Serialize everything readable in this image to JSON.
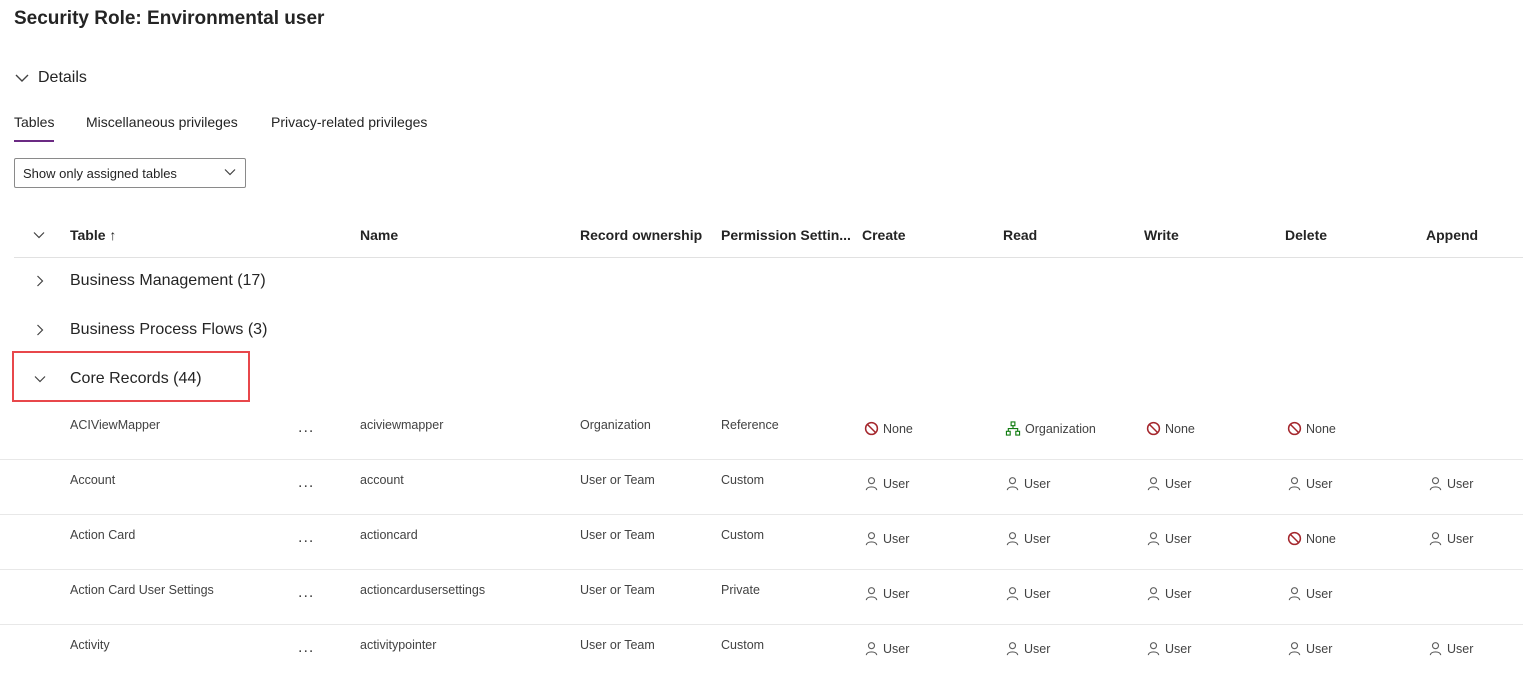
{
  "page_title": "Security Role: Environmental user",
  "details_label": "Details",
  "tabs": [
    {
      "label": "Tables",
      "active": true
    },
    {
      "label": "Miscellaneous privileges",
      "active": false
    },
    {
      "label": "Privacy-related privileges",
      "active": false
    }
  ],
  "filter": {
    "value": "Show only assigned tables"
  },
  "columns": {
    "table": "Table ↑",
    "name": "Name",
    "ownership": "Record ownership",
    "permission": "Permission Settin...",
    "create": "Create",
    "read": "Read",
    "write": "Write",
    "delete": "Delete",
    "append": "Append"
  },
  "groups": [
    {
      "label": "Business Management (17)",
      "expanded": false
    },
    {
      "label": "Business Process Flows (3)",
      "expanded": false
    },
    {
      "label": "Core Records (44)",
      "expanded": true
    }
  ],
  "rows": [
    {
      "table": "ACIViewMapper",
      "more": "...",
      "name": "aciviewmapper",
      "ownership": "Organization",
      "permission": "Reference",
      "create": {
        "icon": "none-icon",
        "label": "None"
      },
      "read": {
        "icon": "organization-icon",
        "label": "Organization"
      },
      "write": {
        "icon": "none-icon",
        "label": "None"
      },
      "delete": {
        "icon": "none-icon",
        "label": "None"
      },
      "append": null
    },
    {
      "table": "Account",
      "more": "...",
      "name": "account",
      "ownership": "User or Team",
      "permission": "Custom",
      "create": {
        "icon": "user-icon",
        "label": "User"
      },
      "read": {
        "icon": "user-icon",
        "label": "User"
      },
      "write": {
        "icon": "user-icon",
        "label": "User"
      },
      "delete": {
        "icon": "user-icon",
        "label": "User"
      },
      "append": {
        "icon": "user-icon",
        "label": "User"
      }
    },
    {
      "table": "Action Card",
      "more": "...",
      "name": "actioncard",
      "ownership": "User or Team",
      "permission": "Custom",
      "create": {
        "icon": "user-icon",
        "label": "User"
      },
      "read": {
        "icon": "user-icon",
        "label": "User"
      },
      "write": {
        "icon": "user-icon",
        "label": "User"
      },
      "delete": {
        "icon": "none-icon",
        "label": "None"
      },
      "append": {
        "icon": "user-icon",
        "label": "User"
      }
    },
    {
      "table": "Action Card User Settings",
      "more": "...",
      "name": "actioncardusersettings",
      "ownership": "User or Team",
      "permission": "Private",
      "create": {
        "icon": "user-icon",
        "label": "User"
      },
      "read": {
        "icon": "user-icon",
        "label": "User"
      },
      "write": {
        "icon": "user-icon",
        "label": "User"
      },
      "delete": {
        "icon": "user-icon",
        "label": "User"
      },
      "append": null
    },
    {
      "table": "Activity",
      "more": "...",
      "name": "activitypointer",
      "ownership": "User or Team",
      "permission": "Custom",
      "create": {
        "icon": "user-icon",
        "label": "User"
      },
      "read": {
        "icon": "user-icon",
        "label": "User"
      },
      "write": {
        "icon": "user-icon",
        "label": "User"
      },
      "delete": {
        "icon": "user-icon",
        "label": "User"
      },
      "append": {
        "icon": "user-icon",
        "label": "User"
      }
    }
  ],
  "colors": {
    "accent": "#6b2a83",
    "none_icon": "#a4262c",
    "organization_icon": "#107c10",
    "highlight_box": "#e8474b"
  }
}
